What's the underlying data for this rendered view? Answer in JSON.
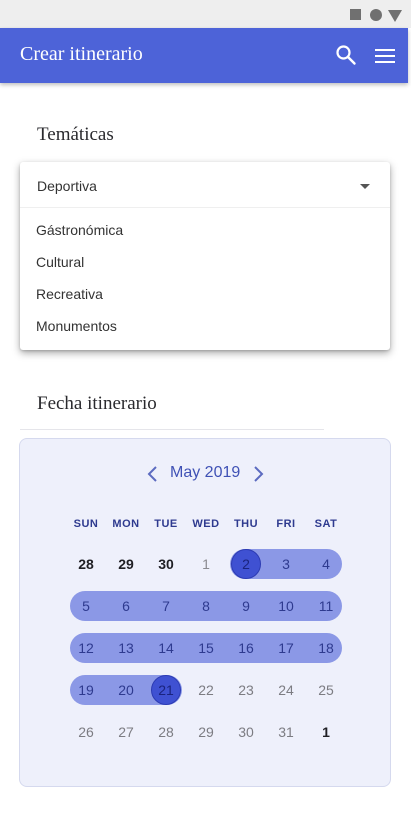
{
  "appbar": {
    "title": "Crear itinerario",
    "color": "#4d63d8"
  },
  "tematicas": {
    "label": "Temáticas",
    "selected": "Deportiva",
    "options": [
      "Gástronómica",
      "Cultural",
      "Recreativa",
      "Monumentos"
    ]
  },
  "fecha": {
    "label": "Fecha itinerario"
  },
  "calendar": {
    "month_label": "May 2019",
    "weekdays": [
      "SUN",
      "MON",
      "TUE",
      "WED",
      "THU",
      "FRI",
      "SAT"
    ],
    "weeks": [
      [
        "28",
        "29",
        "30",
        "1",
        "2",
        "3",
        "4"
      ],
      [
        "5",
        "6",
        "7",
        "8",
        "9",
        "10",
        "11"
      ],
      [
        "12",
        "13",
        "14",
        "15",
        "16",
        "17",
        "18"
      ],
      [
        "19",
        "20",
        "21",
        "22",
        "23",
        "24",
        "25"
      ],
      [
        "26",
        "27",
        "28",
        "29",
        "30",
        "31",
        "1"
      ]
    ],
    "range_start": "2",
    "range_end": "21",
    "range_color": "#8b98e6",
    "endpoint_color": "#3f51d2"
  }
}
